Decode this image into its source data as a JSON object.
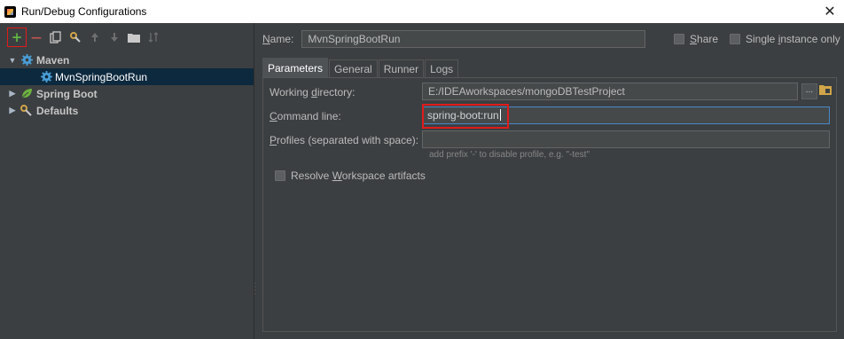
{
  "window": {
    "title": "Run/Debug Configurations",
    "close_glyph": "✕"
  },
  "toolbar": {
    "add_glyph": "+",
    "remove_glyph": "—"
  },
  "tree": {
    "maven": {
      "label": "Maven",
      "arrow": "▼",
      "icon": "gear-icon"
    },
    "maven_child": {
      "label": "MvnSpringBootRun",
      "icon": "gear-icon"
    },
    "spring_boot": {
      "label": "Spring Boot",
      "arrow": "▶",
      "icon": "spring-leaf-icon"
    },
    "defaults": {
      "label": "Defaults",
      "arrow": "▶",
      "icon": "defaults-wrench-icon"
    }
  },
  "header": {
    "name_label_u": "N",
    "name_label_rest": "ame:",
    "name_value": "MvnSpringBootRun",
    "share_label_u": "S",
    "share_label_rest": "hare",
    "single_label_pre": "Single ",
    "single_label_u": "i",
    "single_label_rest": "nstance only"
  },
  "tabs": [
    "Parameters",
    "General",
    "Runner",
    "Logs"
  ],
  "params": {
    "wd_label_pre": "Working ",
    "wd_label_u": "d",
    "wd_label_rest": "irectory:",
    "wd_value": "E:/IDEAworkspaces/mongoDBTestProject",
    "wd_btn": "...",
    "cmd_label_pre": "",
    "cmd_label_u": "C",
    "cmd_label_rest": "ommand line:",
    "cmd_value": "spring-boot:run",
    "prof_label_u": "P",
    "prof_label_rest": "rofiles (separated with space):",
    "prof_hint": "add prefix '-' to disable profile, e.g. \"-test\"",
    "resolve_pre": "Resolve ",
    "resolve_u": "W",
    "resolve_rest": "orkspace artifacts"
  },
  "colors": {
    "accent_blue": "#4a88c7",
    "highlight_red": "#e01b1b",
    "selected_row": "#0d293e",
    "add_green": "#62b543"
  }
}
